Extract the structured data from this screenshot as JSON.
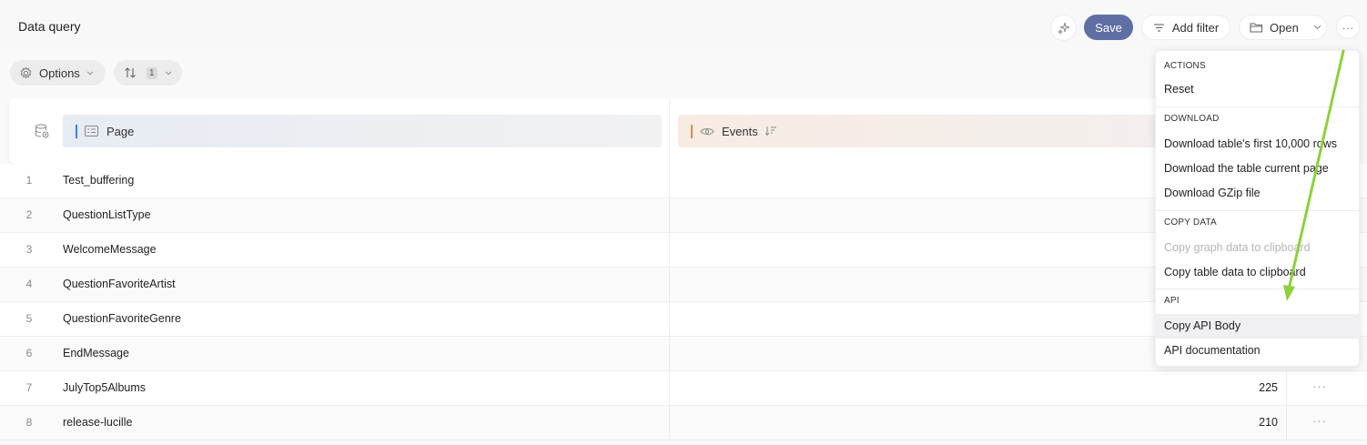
{
  "header": {
    "title": "Data query",
    "save_label": "Save",
    "add_filter_label": "Add filter",
    "open_label": "Open"
  },
  "toolbar": {
    "options_label": "Options",
    "sort_count": "1"
  },
  "table": {
    "columns": [
      "Page",
      "Events"
    ],
    "rows": [
      {
        "num": "1",
        "page": "Test_buffering",
        "events": ""
      },
      {
        "num": "2",
        "page": "QuestionListType",
        "events": ""
      },
      {
        "num": "3",
        "page": "WelcomeMessage",
        "events": ""
      },
      {
        "num": "4",
        "page": "QuestionFavoriteArtist",
        "events": ""
      },
      {
        "num": "5",
        "page": "QuestionFavoriteGenre",
        "events": ""
      },
      {
        "num": "6",
        "page": "EndMessage",
        "events": ""
      },
      {
        "num": "7",
        "page": "JulyTop5Albums",
        "events": "225"
      },
      {
        "num": "8",
        "page": "release-lucille",
        "events": "210"
      }
    ]
  },
  "menu": {
    "sections": [
      {
        "title": "ACTIONS",
        "items": [
          "Reset"
        ]
      },
      {
        "title": "DOWNLOAD",
        "items": [
          "Download table's first 10,000 rows",
          "Download the table current page",
          "Download GZip file"
        ]
      },
      {
        "title": "COPY DATA",
        "items": [
          "Copy graph data to clipboard",
          "Copy table data to clipboard"
        ]
      },
      {
        "title": "API",
        "items": [
          "Copy API Body",
          "API documentation"
        ]
      }
    ]
  },
  "colors": {
    "save_button": "#5f6fa5",
    "page_column_accent": "#3a83d6",
    "events_column_accent": "#e48a3d",
    "annotation_arrow": "#8dd13a"
  },
  "icons": [
    "sparkle-icon",
    "filter-icon",
    "folder-icon",
    "chevron-down-icon",
    "more-icon",
    "gear-icon",
    "sort-icon",
    "database-icon",
    "list-icon",
    "eye-icon",
    "sort-desc-icon"
  ]
}
